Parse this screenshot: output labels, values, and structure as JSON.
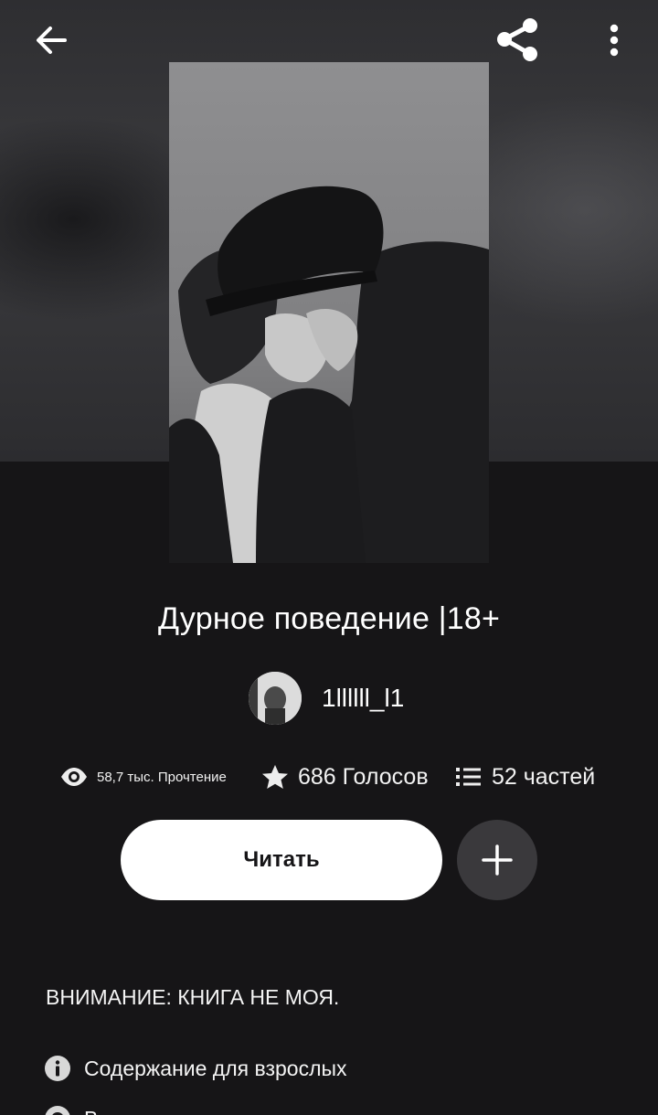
{
  "topbar": {
    "back_icon": "arrow-left-icon",
    "share_icon": "share-icon",
    "more_icon": "more-vertical-icon"
  },
  "book": {
    "title": "Дурное поведение |18+",
    "author": "1llllll_l1"
  },
  "stats": {
    "views": "58,7 тыс. Прочтение",
    "votes": "686 Голосов",
    "parts": "52 частей"
  },
  "actions": {
    "read_label": "Читать",
    "add_icon": "plus-icon"
  },
  "description": {
    "notice": "ВНИМАНИЕ: КНИГА НЕ МОЯ."
  },
  "tags": {
    "mature_label": "Содержание для взрослых",
    "second_label": "В"
  },
  "colors": {
    "background": "#161517",
    "read_button": "#ffffff",
    "add_button": "#3a393c"
  }
}
